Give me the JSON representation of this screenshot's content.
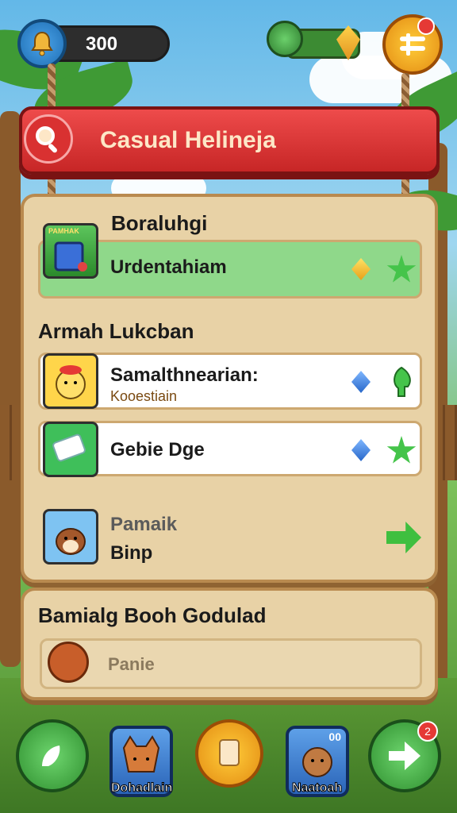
{
  "hud": {
    "coins": "300"
  },
  "banner": {
    "title": "Casual Helineja"
  },
  "section1": {
    "title": "Boraluhgi",
    "item": {
      "title": "Urdentahiam",
      "thumb_tag": "PAMHAK"
    }
  },
  "section2": {
    "title": "Armah Lukcban",
    "items": [
      {
        "title": "Samalthnearian:",
        "subtitle": "Kooestiain"
      },
      {
        "title": "Gebie Dge"
      },
      {
        "title": "Pamaik",
        "subtitle": "Binp"
      }
    ]
  },
  "section3": {
    "title": "Bamialg Booh Godulad",
    "slot_label": "Panie"
  },
  "nav": {
    "left_card_label": "Dohadlain",
    "right_card_label": "Naatoah",
    "right_card_badge": "00",
    "right_button_badge": "2"
  },
  "colors": {
    "banner": "#d93131",
    "panel": "#e8d2a6",
    "accent_green": "#45c44a"
  },
  "icons": [
    "bell-icon",
    "globe-icon",
    "gem-icon",
    "menu-icon",
    "search-icon",
    "star-icon",
    "diamond-icon",
    "arrow-right-icon",
    "hand-icon",
    "paper-icon"
  ]
}
